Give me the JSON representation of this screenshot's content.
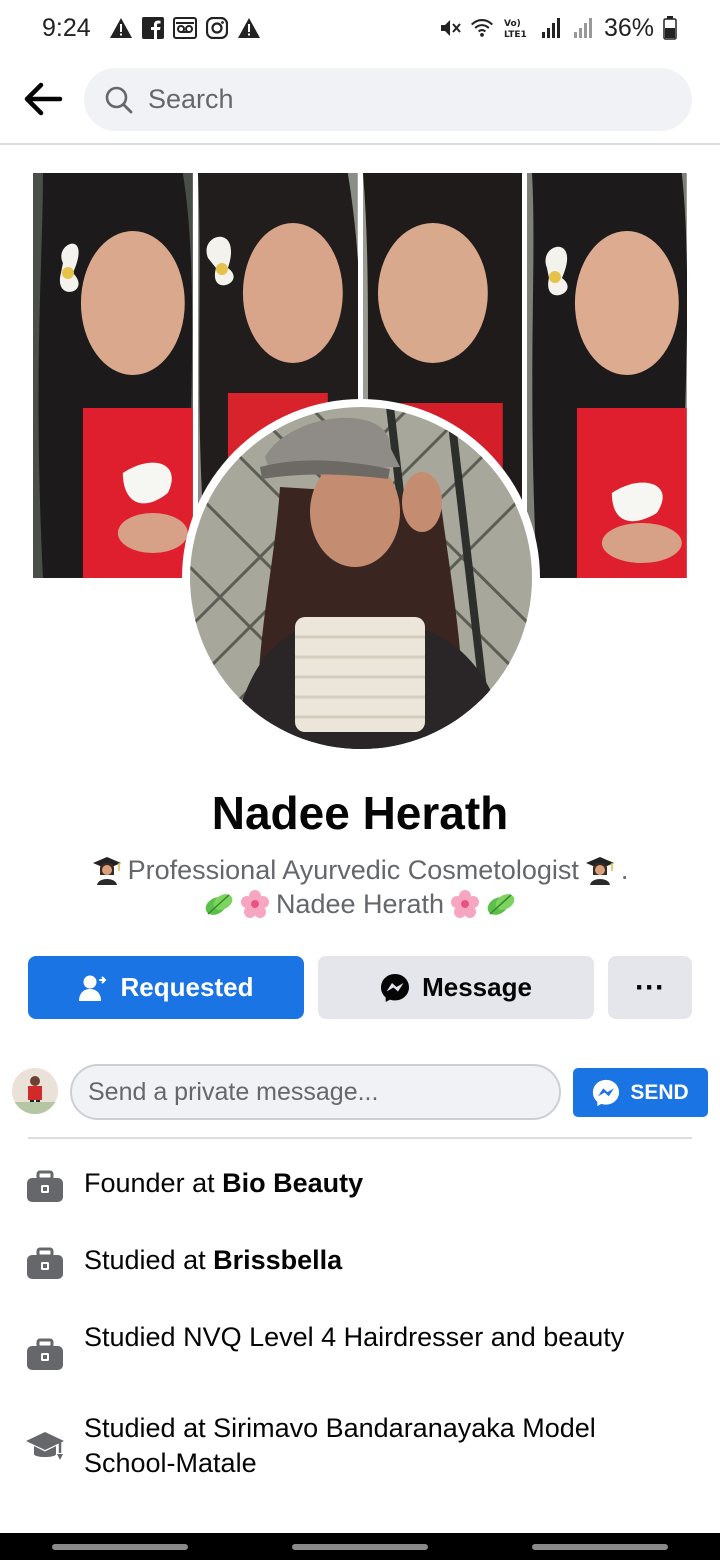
{
  "status_bar": {
    "time": "9:24",
    "battery": "36%",
    "left_icons": [
      "warning-icon",
      "facebook-icon",
      "voicemail-icon",
      "instagram-icon",
      "warning-icon"
    ],
    "right_icons": [
      "mute-icon",
      "wifi-icon",
      "volte-icon",
      "signal-icon",
      "signal-icon",
      "battery-icon"
    ]
  },
  "search": {
    "placeholder": "Search"
  },
  "profile": {
    "name": "Nadee Herath",
    "bio_line1": "Professional Ayurvedic Cosmetologist",
    "bio_line1_suffix": ".",
    "bio_line2": "Nadee Herath"
  },
  "actions": {
    "requested_label": "Requested",
    "message_label": "Message",
    "more_label": "···"
  },
  "message_box": {
    "placeholder": "Send a private message...",
    "send_label": "SEND"
  },
  "details": [
    {
      "icon": "briefcase-icon",
      "prefix": "Founder at ",
      "bold": "Bio Beauty"
    },
    {
      "icon": "briefcase-icon",
      "prefix": "Studied at ",
      "bold": "Brissbella"
    },
    {
      "icon": "briefcase-icon",
      "prefix": "Studied NVQ Level 4 Hairdresser and beauty",
      "bold": ""
    },
    {
      "icon": "graduation-cap-icon",
      "prefix": "Studied at Sirimavo Bandaranayaka Model School-Matale",
      "bold": ""
    }
  ],
  "colors": {
    "primary": "#1b74e4",
    "secondary_bg": "#e4e6eb",
    "muted_text": "#65676b"
  }
}
